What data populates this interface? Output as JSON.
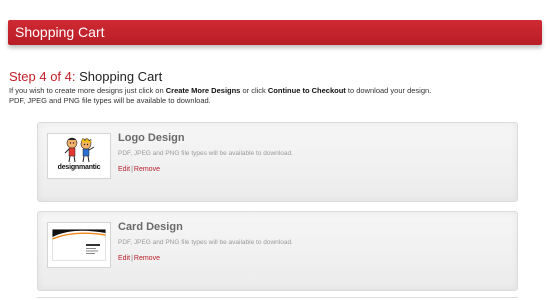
{
  "header": {
    "title": "Shopping Cart"
  },
  "step": {
    "prefix": "Step 4 of 4:",
    "title": "Shopping Cart"
  },
  "intro": {
    "line1_before": "If you wish to create more designs just click on ",
    "line1_link1": "Create More Designs",
    "line1_middle": " or click ",
    "line1_link2": "Continue to Checkout",
    "line1_after": " to download your design.",
    "line2": "PDF, JPEG and PNG file types will be available to download."
  },
  "items": [
    {
      "title": "Logo Design",
      "description": "PDF, JPEG and PNG file types will be available to download.",
      "edit_label": "Edit",
      "remove_label": "Remove",
      "thumbnail_text": "designmantic"
    },
    {
      "title": "Card Design",
      "description": "PDF, JPEG and PNG file types will be available to download.",
      "edit_label": "Edit",
      "remove_label": "Remove"
    }
  ],
  "colors": {
    "accent": "#c0202a",
    "header_bg": "#c4232c",
    "card_bg": "#f2f2f2"
  }
}
